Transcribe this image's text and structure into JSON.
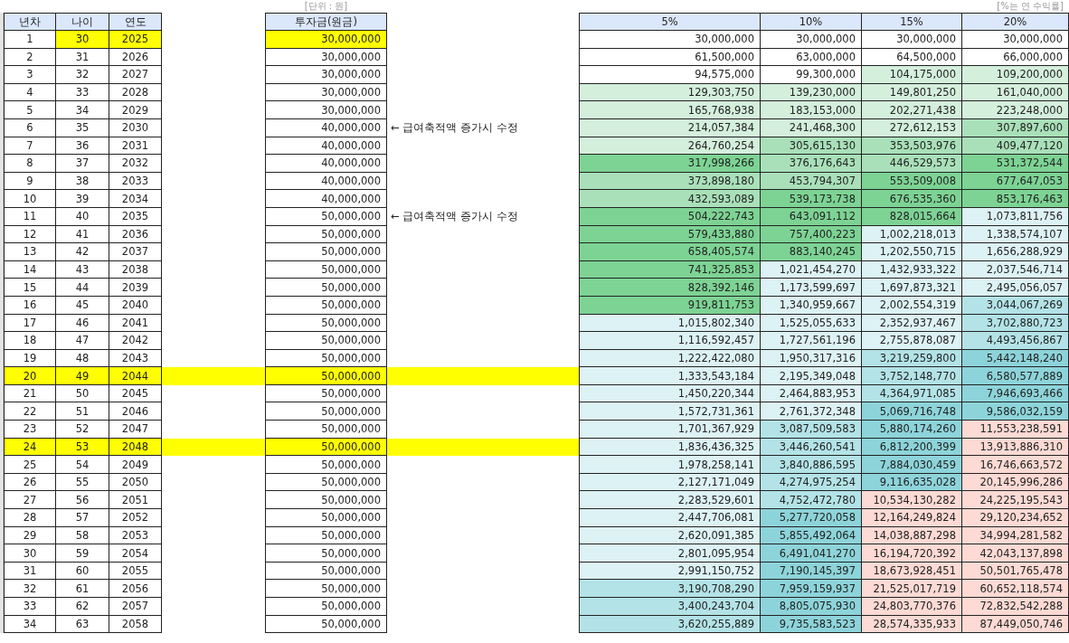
{
  "unit_note": "[단위 : 원]",
  "rate_note": "[%는 연 수익률]",
  "left_columns": [
    "년차",
    "나이",
    "연도"
  ],
  "principal_column": "투자금(원금)",
  "rate_columns": [
    "5%",
    "10%",
    "15%",
    "20%"
  ],
  "rows": [
    {
      "n": "1",
      "age": "30",
      "year": "2025",
      "principal": "30,000,000",
      "highlighted": false,
      "input_highlighted": true,
      "values": [
        {
          "text": "30,000,000",
          "color": "#ffffff"
        },
        {
          "text": "30,000,000",
          "color": "#ffffff"
        },
        {
          "text": "30,000,000",
          "color": "#ffffff"
        },
        {
          "text": "30,000,000",
          "color": "#ffffff"
        }
      ]
    },
    {
      "n": "2",
      "age": "31",
      "year": "2026",
      "principal": "30,000,000",
      "highlighted": false,
      "input_highlighted": false,
      "values": [
        {
          "text": "61,500,000",
          "color": "#ffffff"
        },
        {
          "text": "63,000,000",
          "color": "#ffffff"
        },
        {
          "text": "64,500,000",
          "color": "#ffffff"
        },
        {
          "text": "66,000,000",
          "color": "#ffffff"
        }
      ]
    },
    {
      "n": "3",
      "age": "32",
      "year": "2027",
      "principal": "30,000,000",
      "highlighted": false,
      "input_highlighted": false,
      "values": [
        {
          "text": "94,575,000",
          "color": "#ffffff"
        },
        {
          "text": "99,300,000",
          "color": "#ffffff"
        },
        {
          "text": "104,175,000",
          "color": "#d4efdc"
        },
        {
          "text": "109,200,000",
          "color": "#d4efdc"
        }
      ]
    },
    {
      "n": "4",
      "age": "33",
      "year": "2028",
      "principal": "30,000,000",
      "highlighted": false,
      "input_highlighted": false,
      "values": [
        {
          "text": "129,303,750",
          "color": "#d4efdc"
        },
        {
          "text": "139,230,000",
          "color": "#d4efdc"
        },
        {
          "text": "149,801,250",
          "color": "#d4efdc"
        },
        {
          "text": "161,040,000",
          "color": "#d4efdc"
        }
      ]
    },
    {
      "n": "5",
      "age": "34",
      "year": "2029",
      "principal": "30,000,000",
      "highlighted": false,
      "input_highlighted": false,
      "values": [
        {
          "text": "165,768,938",
          "color": "#d4efdc"
        },
        {
          "text": "183,153,000",
          "color": "#d4efdc"
        },
        {
          "text": "202,271,438",
          "color": "#d4efdc"
        },
        {
          "text": "223,248,000",
          "color": "#d4efdc"
        }
      ]
    },
    {
      "n": "6",
      "age": "35",
      "year": "2030",
      "principal": "40,000,000",
      "note": "← 급여축적액 증가시 수정",
      "highlighted": false,
      "input_highlighted": false,
      "values": [
        {
          "text": "214,057,384",
          "color": "#d4efdc"
        },
        {
          "text": "241,468,300",
          "color": "#d4efdc"
        },
        {
          "text": "272,612,153",
          "color": "#d4efdc"
        },
        {
          "text": "307,897,600",
          "color": "#a9e0b9"
        }
      ]
    },
    {
      "n": "7",
      "age": "36",
      "year": "2031",
      "principal": "40,000,000",
      "highlighted": false,
      "input_highlighted": false,
      "values": [
        {
          "text": "264,760,254",
          "color": "#d4efdc"
        },
        {
          "text": "305,615,130",
          "color": "#a9e0b9"
        },
        {
          "text": "353,503,976",
          "color": "#a9e0b9"
        },
        {
          "text": "409,477,120",
          "color": "#a9e0b9"
        }
      ]
    },
    {
      "n": "8",
      "age": "37",
      "year": "2032",
      "principal": "40,000,000",
      "highlighted": false,
      "input_highlighted": false,
      "values": [
        {
          "text": "317,998,266",
          "color": "#7dd394"
        },
        {
          "text": "376,176,643",
          "color": "#a9e0b9"
        },
        {
          "text": "446,529,573",
          "color": "#a9e0b9"
        },
        {
          "text": "531,372,544",
          "color": "#7dd394"
        }
      ]
    },
    {
      "n": "9",
      "age": "38",
      "year": "2033",
      "principal": "40,000,000",
      "highlighted": false,
      "input_highlighted": false,
      "values": [
        {
          "text": "373,898,180",
          "color": "#a9e0b9"
        },
        {
          "text": "453,794,307",
          "color": "#a9e0b9"
        },
        {
          "text": "553,509,008",
          "color": "#7dd394"
        },
        {
          "text": "677,647,053",
          "color": "#7dd394"
        }
      ]
    },
    {
      "n": "10",
      "age": "39",
      "year": "2034",
      "principal": "40,000,000",
      "highlighted": false,
      "input_highlighted": false,
      "values": [
        {
          "text": "432,593,089",
          "color": "#a9e0b9"
        },
        {
          "text": "539,173,738",
          "color": "#7dd394"
        },
        {
          "text": "676,535,360",
          "color": "#7dd394"
        },
        {
          "text": "853,176,463",
          "color": "#7dd394"
        }
      ]
    },
    {
      "n": "11",
      "age": "40",
      "year": "2035",
      "principal": "50,000,000",
      "note": "← 급여축적액 증가시 수정",
      "highlighted": false,
      "input_highlighted": false,
      "values": [
        {
          "text": "504,222,743",
          "color": "#7dd394"
        },
        {
          "text": "643,091,112",
          "color": "#7dd394"
        },
        {
          "text": "828,015,664",
          "color": "#7dd394"
        },
        {
          "text": "1,073,811,756",
          "color": "#ddf2f4"
        }
      ]
    },
    {
      "n": "12",
      "age": "41",
      "year": "2036",
      "principal": "50,000,000",
      "highlighted": false,
      "input_highlighted": false,
      "values": [
        {
          "text": "579,433,880",
          "color": "#7dd394"
        },
        {
          "text": "757,400,223",
          "color": "#7dd394"
        },
        {
          "text": "1,002,218,013",
          "color": "#ddf2f4"
        },
        {
          "text": "1,338,574,107",
          "color": "#ddf2f4"
        }
      ]
    },
    {
      "n": "13",
      "age": "42",
      "year": "2037",
      "principal": "50,000,000",
      "highlighted": false,
      "input_highlighted": false,
      "values": [
        {
          "text": "658,405,574",
          "color": "#7dd394"
        },
        {
          "text": "883,140,245",
          "color": "#7dd394"
        },
        {
          "text": "1,202,550,715",
          "color": "#ddf2f4"
        },
        {
          "text": "1,656,288,929",
          "color": "#ddf2f4"
        }
      ]
    },
    {
      "n": "14",
      "age": "43",
      "year": "2038",
      "principal": "50,000,000",
      "highlighted": false,
      "input_highlighted": false,
      "values": [
        {
          "text": "741,325,853",
          "color": "#7dd394"
        },
        {
          "text": "1,021,454,270",
          "color": "#ddf2f4"
        },
        {
          "text": "1,432,933,322",
          "color": "#ddf2f4"
        },
        {
          "text": "2,037,546,714",
          "color": "#ddf2f4"
        }
      ]
    },
    {
      "n": "15",
      "age": "44",
      "year": "2039",
      "principal": "50,000,000",
      "highlighted": false,
      "input_highlighted": false,
      "values": [
        {
          "text": "828,392,146",
          "color": "#7dd394"
        },
        {
          "text": "1,173,599,697",
          "color": "#ddf2f4"
        },
        {
          "text": "1,697,873,321",
          "color": "#ddf2f4"
        },
        {
          "text": "2,495,056,057",
          "color": "#ddf2f4"
        }
      ]
    },
    {
      "n": "16",
      "age": "45",
      "year": "2040",
      "principal": "50,000,000",
      "highlighted": false,
      "input_highlighted": false,
      "values": [
        {
          "text": "919,811,753",
          "color": "#7dd394"
        },
        {
          "text": "1,340,959,667",
          "color": "#ddf2f4"
        },
        {
          "text": "2,002,554,319",
          "color": "#ddf2f4"
        },
        {
          "text": "3,044,067,269",
          "color": "#b3e3e7"
        }
      ]
    },
    {
      "n": "17",
      "age": "46",
      "year": "2041",
      "principal": "50,000,000",
      "highlighted": false,
      "input_highlighted": false,
      "values": [
        {
          "text": "1,015,802,340",
          "color": "#ddf2f4"
        },
        {
          "text": "1,525,055,633",
          "color": "#ddf2f4"
        },
        {
          "text": "2,352,937,467",
          "color": "#ddf2f4"
        },
        {
          "text": "3,702,880,723",
          "color": "#b3e3e7"
        }
      ]
    },
    {
      "n": "18",
      "age": "47",
      "year": "2042",
      "principal": "50,000,000",
      "highlighted": false,
      "input_highlighted": false,
      "values": [
        {
          "text": "1,116,592,457",
          "color": "#ddf2f4"
        },
        {
          "text": "1,727,561,196",
          "color": "#ddf2f4"
        },
        {
          "text": "2,755,878,087",
          "color": "#ddf2f4"
        },
        {
          "text": "4,493,456,867",
          "color": "#b3e3e7"
        }
      ]
    },
    {
      "n": "19",
      "age": "48",
      "year": "2043",
      "principal": "50,000,000",
      "highlighted": false,
      "input_highlighted": false,
      "values": [
        {
          "text": "1,222,422,080",
          "color": "#ddf2f4"
        },
        {
          "text": "1,950,317,316",
          "color": "#ddf2f4"
        },
        {
          "text": "3,219,259,800",
          "color": "#b3e3e7"
        },
        {
          "text": "5,442,148,240",
          "color": "#8dd4da"
        }
      ]
    },
    {
      "n": "20",
      "age": "49",
      "year": "2044",
      "principal": "50,000,000",
      "highlighted": true,
      "input_highlighted": true,
      "values": [
        {
          "text": "1,333,543,184",
          "color": "#ddf2f4"
        },
        {
          "text": "2,195,349,048",
          "color": "#ddf2f4"
        },
        {
          "text": "3,752,148,770",
          "color": "#b3e3e7"
        },
        {
          "text": "6,580,577,889",
          "color": "#8dd4da"
        }
      ]
    },
    {
      "n": "21",
      "age": "50",
      "year": "2045",
      "principal": "50,000,000",
      "highlighted": false,
      "input_highlighted": false,
      "values": [
        {
          "text": "1,450,220,344",
          "color": "#ddf2f4"
        },
        {
          "text": "2,464,883,953",
          "color": "#ddf2f4"
        },
        {
          "text": "4,364,971,085",
          "color": "#b3e3e7"
        },
        {
          "text": "7,946,693,466",
          "color": "#8dd4da"
        }
      ]
    },
    {
      "n": "22",
      "age": "51",
      "year": "2046",
      "principal": "50,000,000",
      "highlighted": false,
      "input_highlighted": false,
      "values": [
        {
          "text": "1,572,731,361",
          "color": "#ddf2f4"
        },
        {
          "text": "2,761,372,348",
          "color": "#ddf2f4"
        },
        {
          "text": "5,069,716,748",
          "color": "#8dd4da"
        },
        {
          "text": "9,586,032,159",
          "color": "#8dd4da"
        }
      ]
    },
    {
      "n": "23",
      "age": "52",
      "year": "2047",
      "principal": "50,000,000",
      "highlighted": false,
      "input_highlighted": false,
      "values": [
        {
          "text": "1,701,367,929",
          "color": "#ddf2f4"
        },
        {
          "text": "3,087,509,583",
          "color": "#b3e3e7"
        },
        {
          "text": "5,880,174,260",
          "color": "#8dd4da"
        },
        {
          "text": "11,553,238,591",
          "color": "#fddad4"
        }
      ]
    },
    {
      "n": "24",
      "age": "53",
      "year": "2048",
      "principal": "50,000,000",
      "highlighted": true,
      "input_highlighted": true,
      "values": [
        {
          "text": "1,836,436,325",
          "color": "#ddf2f4"
        },
        {
          "text": "3,446,260,541",
          "color": "#b3e3e7"
        },
        {
          "text": "6,812,200,399",
          "color": "#8dd4da"
        },
        {
          "text": "13,913,886,310",
          "color": "#fddad4"
        }
      ]
    },
    {
      "n": "25",
      "age": "54",
      "year": "2049",
      "principal": "50,000,000",
      "highlighted": false,
      "input_highlighted": false,
      "values": [
        {
          "text": "1,978,258,141",
          "color": "#ddf2f4"
        },
        {
          "text": "3,840,886,595",
          "color": "#b3e3e7"
        },
        {
          "text": "7,884,030,459",
          "color": "#8dd4da"
        },
        {
          "text": "16,746,663,572",
          "color": "#fddad4"
        }
      ]
    },
    {
      "n": "26",
      "age": "55",
      "year": "2050",
      "principal": "50,000,000",
      "highlighted": false,
      "input_highlighted": false,
      "values": [
        {
          "text": "2,127,171,049",
          "color": "#ddf2f4"
        },
        {
          "text": "4,274,975,254",
          "color": "#b3e3e7"
        },
        {
          "text": "9,116,635,028",
          "color": "#8dd4da"
        },
        {
          "text": "20,145,996,286",
          "color": "#fddad4"
        }
      ]
    },
    {
      "n": "27",
      "age": "56",
      "year": "2051",
      "principal": "50,000,000",
      "highlighted": false,
      "input_highlighted": false,
      "values": [
        {
          "text": "2,283,529,601",
          "color": "#ddf2f4"
        },
        {
          "text": "4,752,472,780",
          "color": "#b3e3e7"
        },
        {
          "text": "10,534,130,282",
          "color": "#fddad4"
        },
        {
          "text": "24,225,195,543",
          "color": "#fddad4"
        }
      ]
    },
    {
      "n": "28",
      "age": "57",
      "year": "2052",
      "principal": "50,000,000",
      "highlighted": false,
      "input_highlighted": false,
      "values": [
        {
          "text": "2,447,706,081",
          "color": "#ddf2f4"
        },
        {
          "text": "5,277,720,058",
          "color": "#8dd4da"
        },
        {
          "text": "12,164,249,824",
          "color": "#fddad4"
        },
        {
          "text": "29,120,234,652",
          "color": "#fddad4"
        }
      ]
    },
    {
      "n": "29",
      "age": "58",
      "year": "2053",
      "principal": "50,000,000",
      "highlighted": false,
      "input_highlighted": false,
      "values": [
        {
          "text": "2,620,091,385",
          "color": "#ddf2f4"
        },
        {
          "text": "5,855,492,064",
          "color": "#8dd4da"
        },
        {
          "text": "14,038,887,298",
          "color": "#fddad4"
        },
        {
          "text": "34,994,281,582",
          "color": "#fddad4"
        }
      ]
    },
    {
      "n": "30",
      "age": "59",
      "year": "2054",
      "principal": "50,000,000",
      "highlighted": false,
      "input_highlighted": false,
      "values": [
        {
          "text": "2,801,095,954",
          "color": "#ddf2f4"
        },
        {
          "text": "6,491,041,270",
          "color": "#8dd4da"
        },
        {
          "text": "16,194,720,392",
          "color": "#fddad4"
        },
        {
          "text": "42,043,137,898",
          "color": "#fddad4"
        }
      ]
    },
    {
      "n": "31",
      "age": "60",
      "year": "2055",
      "principal": "50,000,000",
      "highlighted": false,
      "input_highlighted": false,
      "values": [
        {
          "text": "2,991,150,752",
          "color": "#ddf2f4"
        },
        {
          "text": "7,190,145,397",
          "color": "#8dd4da"
        },
        {
          "text": "18,673,928,451",
          "color": "#fddad4"
        },
        {
          "text": "50,501,765,478",
          "color": "#fddad4"
        }
      ]
    },
    {
      "n": "32",
      "age": "61",
      "year": "2056",
      "principal": "50,000,000",
      "highlighted": false,
      "input_highlighted": false,
      "values": [
        {
          "text": "3,190,708,290",
          "color": "#b3e3e7"
        },
        {
          "text": "7,959,159,937",
          "color": "#8dd4da"
        },
        {
          "text": "21,525,017,719",
          "color": "#fddad4"
        },
        {
          "text": "60,652,118,574",
          "color": "#fddad4"
        }
      ]
    },
    {
      "n": "33",
      "age": "62",
      "year": "2057",
      "principal": "50,000,000",
      "highlighted": false,
      "input_highlighted": false,
      "values": [
        {
          "text": "3,400,243,704",
          "color": "#b3e3e7"
        },
        {
          "text": "8,805,075,930",
          "color": "#8dd4da"
        },
        {
          "text": "24,803,770,376",
          "color": "#fddad4"
        },
        {
          "text": "72,832,542,288",
          "color": "#fddad4"
        }
      ]
    },
    {
      "n": "34",
      "age": "63",
      "year": "2058",
      "principal": "50,000,000",
      "highlighted": false,
      "input_highlighted": false,
      "values": [
        {
          "text": "3,620,255,889",
          "color": "#b3e3e7"
        },
        {
          "text": "9,735,583,523",
          "color": "#8dd4da"
        },
        {
          "text": "28,574,335,933",
          "color": "#fddad4"
        },
        {
          "text": "87,449,050,746",
          "color": "#fddad4"
        }
      ]
    }
  ]
}
